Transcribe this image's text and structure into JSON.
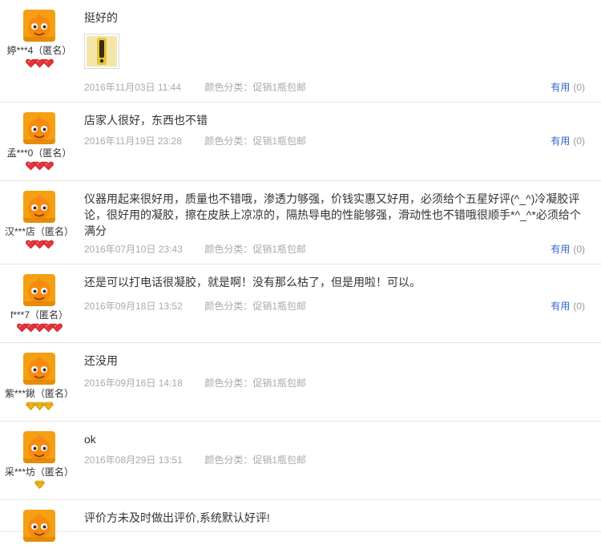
{
  "reviews": [
    {
      "username": "婷***4（匿名）",
      "text": "挺好的",
      "has_photo": true,
      "date": "2016年11月03日 11:44",
      "sku": "颜色分类：促销1瓶包邮",
      "useful_label": "有用",
      "useful_count": "(0)",
      "rank": {
        "type": "heart",
        "count": 3
      }
    },
    {
      "username": "孟***0（匿名）",
      "text": "店家人很好，东西也不错",
      "has_photo": false,
      "date": "2016年11月19日 23:28",
      "sku": "颜色分类：促销1瓶包邮",
      "useful_label": "有用",
      "useful_count": "(0)",
      "rank": {
        "type": "heart",
        "count": 3
      }
    },
    {
      "username": "汉***店（匿名）",
      "text": "仪器用起来很好用，质量也不错哦，渗透力够强，价钱实惠又好用，必须给个五星好评(^_^)冷凝胶评论，很好用的凝胶，擦在皮肤上凉凉的，隔热导电的性能够强，滑动性也不错哦很顺手*^_^*必须给个满分",
      "has_photo": false,
      "date": "2016年07月10日 23:43",
      "sku": "颜色分类：促销1瓶包邮",
      "useful_label": "有用",
      "useful_count": "(0)",
      "rank": {
        "type": "heart",
        "count": 3
      }
    },
    {
      "username": "f***7（匿名）",
      "text": "还是可以打电话很凝胶，就是啊！没有那么枯了，但是用啦！可以。",
      "has_photo": false,
      "date": "2016年09月18日 13:52",
      "sku": "颜色分类：促销1瓶包邮",
      "useful_label": "有用",
      "useful_count": "(0)",
      "rank": {
        "type": "heart",
        "count": 5
      }
    },
    {
      "username": "紫***鍬（匿名）",
      "text": "还没用",
      "has_photo": false,
      "date": "2016年09月16日 14:18",
      "sku": "颜色分类：促销1瓶包邮",
      "useful_label": "",
      "useful_count": "",
      "rank": {
        "type": "diamond",
        "count": 3
      }
    },
    {
      "username": "采***坊（匿名）",
      "text": "ok",
      "has_photo": false,
      "date": "2016年08月29日 13:51",
      "sku": "颜色分类：促销1瓶包邮",
      "useful_label": "",
      "useful_count": "",
      "rank": {
        "type": "diamond",
        "count": 1
      }
    },
    {
      "username": "",
      "text": "评价方未及时做出评价,系统默认好评!",
      "has_photo": false,
      "date": "",
      "sku": "",
      "useful_label": "",
      "useful_count": "",
      "rank": {
        "type": "none",
        "count": 0
      }
    }
  ],
  "colors": {
    "link": "#3366cc",
    "meta": "#aaaaaa",
    "divider": "#e6e6e6",
    "heart": "#e8333a",
    "diamond": "#f2b81c",
    "avatar_bg": "#f4a012"
  },
  "icons": {
    "avatar": "taobao-mascot-avatar-icon",
    "heart_rank": "red-heart-rank-icon",
    "diamond_rank": "yellow-diamond-rank-icon",
    "photo": "review-photo-thumbnail"
  }
}
